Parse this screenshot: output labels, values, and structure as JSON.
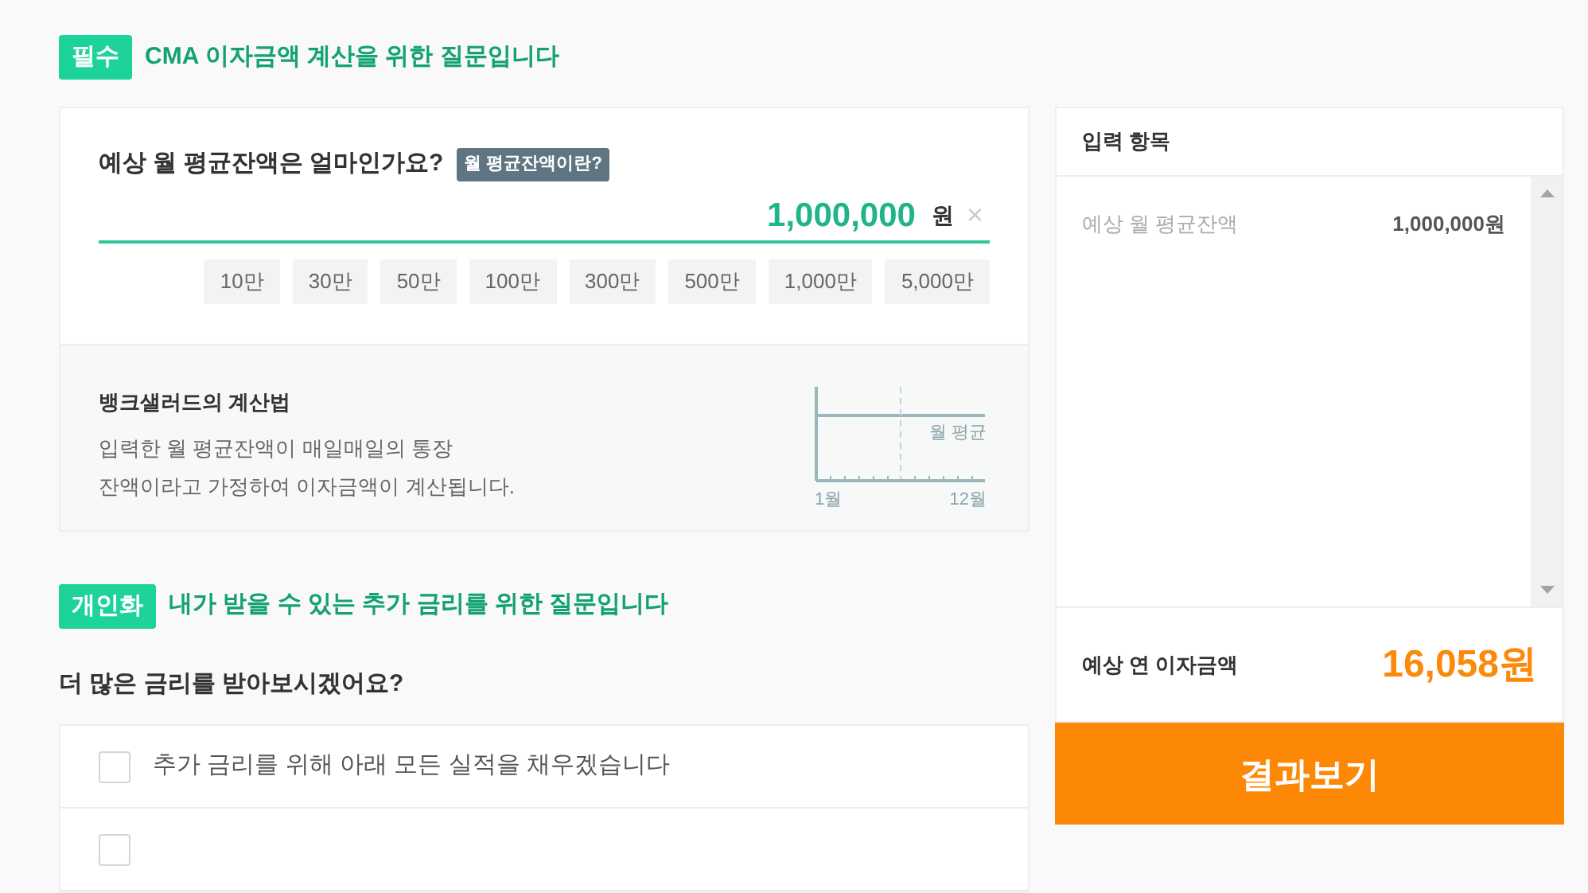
{
  "required_section": {
    "badge": "필수",
    "title": "CMA 이자금액 계산을 위한 질문입니다"
  },
  "balance_question": {
    "label": "예상 월 평균잔액은 얼마인가요?",
    "help_tag": "월 평균잔액이란?",
    "value": "1,000,000",
    "unit": "원",
    "clear": "×",
    "presets": [
      "10만",
      "30만",
      "50만",
      "100만",
      "300만",
      "500만",
      "1,000만",
      "5,000만"
    ]
  },
  "method": {
    "title": "뱅크샐러드의 계산법",
    "lines": [
      "입력한 월 평균잔액이 매일매일의 통장",
      "잔액이라고 가정하여 이자금액이 계산됩니다."
    ],
    "diagram": {
      "line_label": "월 평균",
      "start_label": "1월",
      "end_label": "12월"
    }
  },
  "personal_section": {
    "badge": "개인화",
    "title": "내가 받을 수 있는 추가 금리를 위한 질문입니다"
  },
  "rate_question": "더 많은 금리를 받아보시겠어요?",
  "options": [
    {
      "label": "추가 금리를 위해 아래 모든 실적을 채우겠습니다",
      "checked": false
    },
    {
      "checked": false
    }
  ],
  "summary": {
    "title": "입력 항목",
    "items": [
      {
        "name": "예상 월 평균잔액",
        "value": "1,000,000원"
      }
    ],
    "result_label": "예상 연 이자금액",
    "result_value": "16,058원",
    "button": "결과보기"
  }
}
